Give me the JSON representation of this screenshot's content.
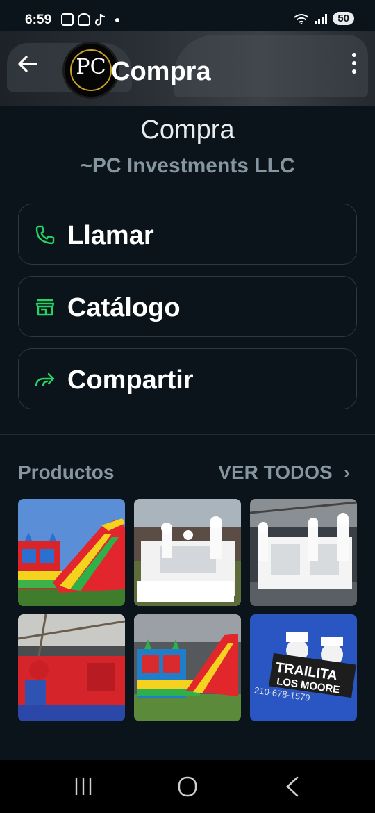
{
  "status_bar": {
    "time": "6:59",
    "battery": "50"
  },
  "header": {
    "title": "Compra",
    "avatar_text": "PC"
  },
  "profile": {
    "name": "Compra",
    "subtitle": "~PC Investments LLC"
  },
  "actions": [
    {
      "label": "Llamar",
      "icon": "phone-icon"
    },
    {
      "label": "Catálogo",
      "icon": "store-icon"
    },
    {
      "label": "Compartir",
      "icon": "share-icon"
    }
  ],
  "products": {
    "title": "Productos",
    "see_all": "VER TODOS",
    "items": [
      {
        "name": "bounce-house-slide"
      },
      {
        "name": "white-bounce-house"
      },
      {
        "name": "white-bounce-house-slide"
      },
      {
        "name": "spiderman-bounce-house"
      },
      {
        "name": "combo-bounce-slide"
      },
      {
        "name": "trailita-los-moore-shirt",
        "shirt_text": "TRAILITA",
        "shirt_text2": "LOS MOORE",
        "shirt_phone": "210-678-1579"
      }
    ]
  },
  "colors": {
    "background": "#0b141a",
    "accent_green": "#25d366",
    "muted_text": "#8696a0"
  }
}
